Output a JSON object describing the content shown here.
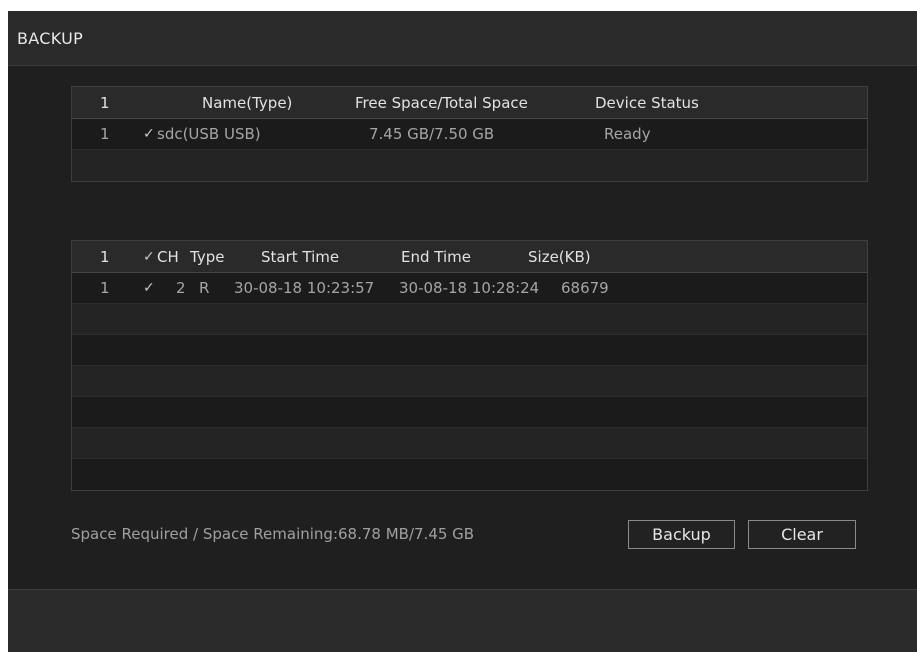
{
  "window": {
    "title": "BACKUP"
  },
  "devices_table": {
    "headers": {
      "index": "1",
      "name": "Name(Type)",
      "space": "Free Space/Total Space",
      "status": "Device Status"
    },
    "rows": [
      {
        "index": "1",
        "check": "✓",
        "name": "sdc(USB USB)",
        "space": "7.45 GB/7.50 GB",
        "status": "Ready"
      }
    ]
  },
  "files_table": {
    "headers": {
      "index": "1",
      "check": "✓",
      "ch": "CH",
      "type": "Type",
      "start": "Start Time",
      "end": "End Time",
      "size": "Size(KB)"
    },
    "rows": [
      {
        "index": "1",
        "check": "✓",
        "ch": "2",
        "type": "R",
        "start": "30-08-18 10:23:57",
        "end": "30-08-18 10:28:24",
        "size": "68679"
      }
    ]
  },
  "summary": {
    "text": "Space Required / Space Remaining:68.78 MB/7.45 GB"
  },
  "buttons": {
    "backup": "Backup",
    "clear": "Clear"
  }
}
